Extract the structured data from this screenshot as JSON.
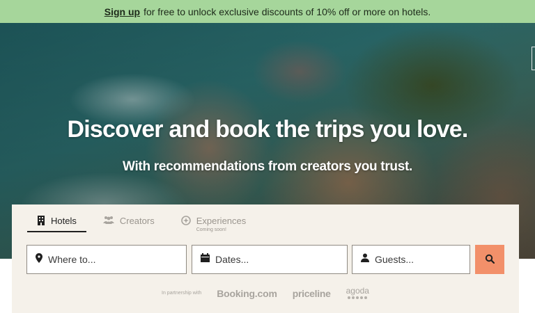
{
  "banner": {
    "link_label": "Sign up",
    "message": "for free to unlock exclusive discounts of 10% off or more on hotels.",
    "background": "#a6d69b"
  },
  "hero": {
    "title": "Discover and book the trips you love.",
    "subtitle": "With recommendations from creators you trust."
  },
  "search": {
    "tabs": [
      {
        "label": "Hotels",
        "icon": "building-icon",
        "active": true
      },
      {
        "label": "Creators",
        "icon": "people-icon",
        "active": false
      },
      {
        "label": "Experiences",
        "icon": "sparkle-badge-icon",
        "active": false,
        "note": "Coming soon!"
      }
    ],
    "where_placeholder": "Where to...",
    "dates_placeholder": "Dates...",
    "guests_placeholder": "Guests...",
    "button_icon": "search-icon",
    "button_color": "#f2906a"
  },
  "partners": {
    "label": "In partnership with",
    "names": [
      "Booking.com",
      "priceline",
      "agoda"
    ]
  }
}
